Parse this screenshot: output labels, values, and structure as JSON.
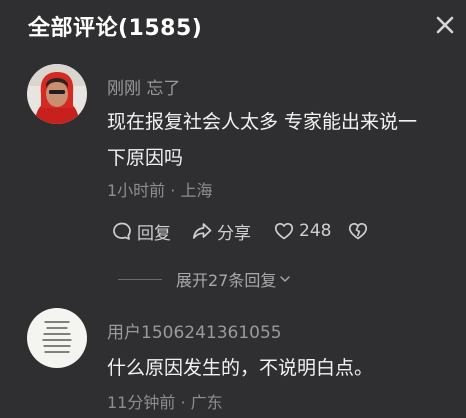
{
  "header": {
    "title": "全部评论(1585)"
  },
  "comments": [
    {
      "user": "刚刚 忘了",
      "lines": [
        "现在报复社会人太多 专家能出来说一",
        "下原因吗"
      ],
      "meta": "1小时前 · 上海",
      "actions": {
        "reply": "回复",
        "share": "分享",
        "likes": "248"
      },
      "expand": "展开27条回复"
    },
    {
      "user": "用户1506241361055",
      "lines": [
        "什么原因发生的，不说明白点。"
      ],
      "meta": "11分钟前 · 广东"
    }
  ],
  "icons": {
    "close": "close-icon",
    "reply": "reply-bubble-icon",
    "share": "share-arrow-icon",
    "like": "heart-icon",
    "dislike": "broken-heart-icon",
    "expand": "chevron-down-icon"
  },
  "colors": {
    "background": "#2f2f31",
    "text": "#f2f2f2",
    "muted": "#9a9a9e"
  }
}
